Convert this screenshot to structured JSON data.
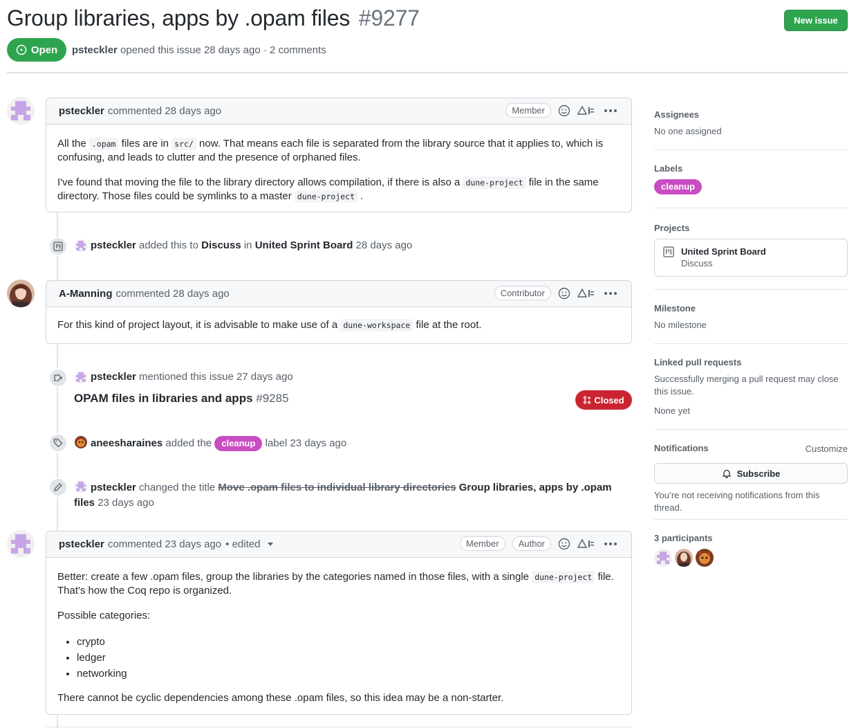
{
  "issue": {
    "title": "Group libraries, apps by .opam files",
    "number": "#9277",
    "state": "Open",
    "author": "psteckler",
    "meta_rest": "opened this issue 28 days ago · 2 comments"
  },
  "header": {
    "new_issue_label": "New issue"
  },
  "comments": [
    {
      "author": "psteckler",
      "time": "commented 28 days ago",
      "roles": [
        "Member"
      ],
      "body": {
        "p1": {
          "a": "All the ",
          "code1": ".opam",
          "b": " files are in ",
          "code2": "src/",
          "c": " now. That means each file is separated from the library source that it applies to, which is confusing, and leads to clutter and the presence of orphaned files."
        },
        "p2": {
          "a": "I've found that moving the file to the library directory allows compilation, if there is also a ",
          "code1": "dune-project",
          "b": " file in the same directory. Those files could be symlinks to a master ",
          "code2": "dune-project",
          "c": " ."
        }
      }
    },
    {
      "author": "A-Manning",
      "time": "commented 28 days ago",
      "roles": [
        "Contributor"
      ],
      "body": {
        "a": "For this kind of project layout, it is advisable to make use of a ",
        "code": "dune-workspace",
        "b": " file at the root."
      }
    },
    {
      "author": "psteckler",
      "time": "commented 23 days ago",
      "edited": "• edited",
      "roles": [
        "Member",
        "Author"
      ],
      "body": {
        "p1": {
          "a": "Better: create a few .opam files, group the libraries by the categories named in those files, with a single ",
          "code": "dune-project",
          "b": " file. That's how the Coq repo is organized."
        },
        "p2": "Possible categories:",
        "list": [
          "crypto",
          "ledger",
          "networking"
        ],
        "p3": "There cannot be cyclic dependencies among these .opam files, so this idea may be a non-starter."
      }
    }
  ],
  "events": {
    "project": {
      "actor": "psteckler",
      "a": "added this to",
      "column": "Discuss",
      "in": "in",
      "board": "United Sprint Board",
      "time": "28 days ago"
    },
    "mention": {
      "actor": "psteckler",
      "text": "mentioned this issue 27 days ago",
      "ref_title": "OPAM files in libraries and apps",
      "ref_number": "#9285",
      "ref_state": "Closed"
    },
    "label": {
      "actor": "aneesharaines",
      "a": "added the",
      "label": "cleanup",
      "b": "label 23 days ago"
    },
    "rename": {
      "actor": "psteckler",
      "a": "changed the title",
      "old": "Move .opam files to individual library directories",
      "new_part1": "Group libraries, apps by .opam",
      "new_part2": "files",
      "time": "23 days ago"
    }
  },
  "sidebar": {
    "assignees": {
      "title": "Assignees",
      "value": "No one assigned"
    },
    "labels": {
      "title": "Labels",
      "items": [
        "cleanup"
      ]
    },
    "projects": {
      "title": "Projects",
      "name": "United Sprint Board",
      "column": "Discuss"
    },
    "milestone": {
      "title": "Milestone",
      "value": "No milestone"
    },
    "linked": {
      "title": "Linked pull requests",
      "text": "Successfully merging a pull request may close this issue.",
      "value": "None yet"
    },
    "notifications": {
      "title": "Notifications",
      "customize": "Customize",
      "subscribe": "Subscribe",
      "text": "You’re not receiving notifications from this thread."
    },
    "participants": {
      "title": "3 participants"
    }
  },
  "colors": {
    "open": "#2ea44f",
    "closed": "#cb2431",
    "label_cleanup": "#c94dc2"
  }
}
